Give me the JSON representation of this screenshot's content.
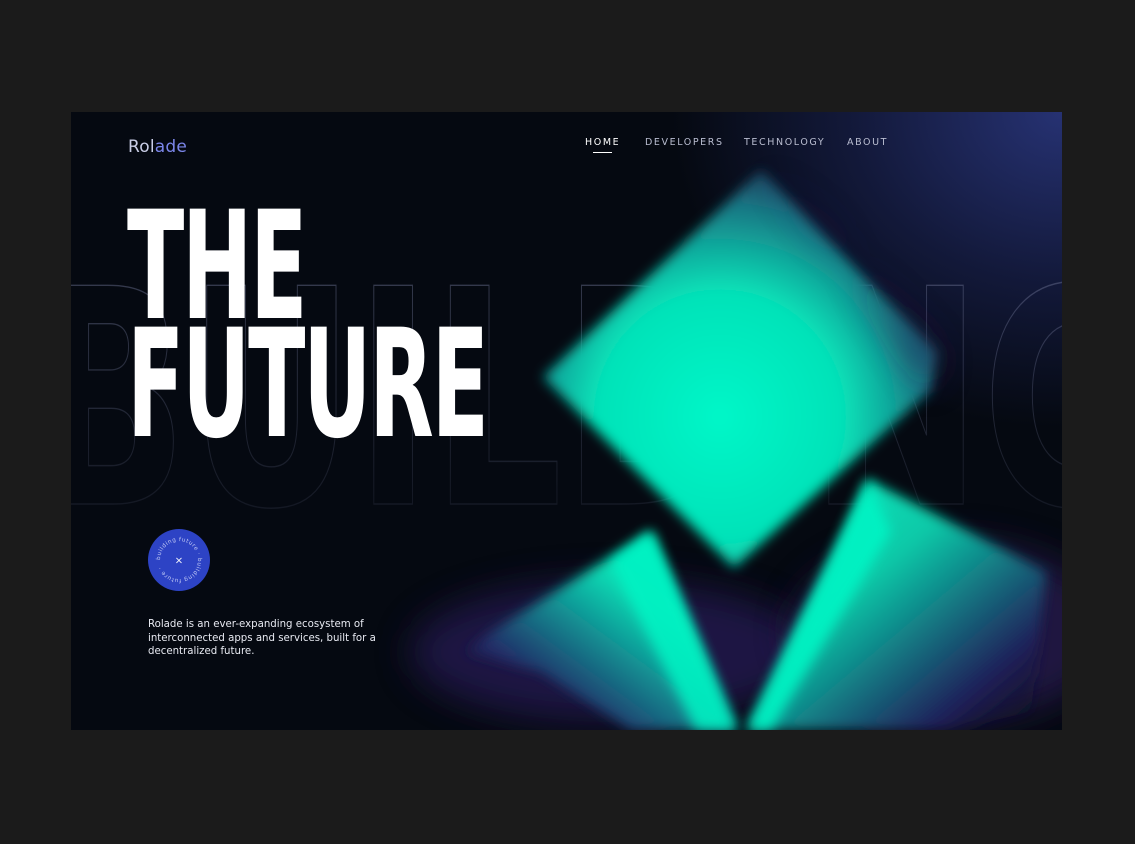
{
  "brand": {
    "logo_main": "Rol",
    "logo_accent": "ade"
  },
  "nav": {
    "items": [
      {
        "label": "HOME",
        "active": true
      },
      {
        "label": "DEVELOPERS",
        "active": false
      },
      {
        "label": "TECHNOLOGY",
        "active": false
      },
      {
        "label": "ABOUT",
        "active": false
      }
    ]
  },
  "hero": {
    "title_line1": "THE",
    "title_line2": "FUTURE",
    "background_word": "BUILDING"
  },
  "badge": {
    "ring_text": "building future · building future ·",
    "center_glyph": "×"
  },
  "description": "Rolade is an ever-expanding ecosystem of interconnected apps and services, built for a decentralized future.",
  "colors": {
    "background": "#050911",
    "accent_green": "#04f2c2",
    "badge_blue": "#2d43c5",
    "logo_accent": "#7b86ea",
    "outer": "#1b1b1b"
  }
}
